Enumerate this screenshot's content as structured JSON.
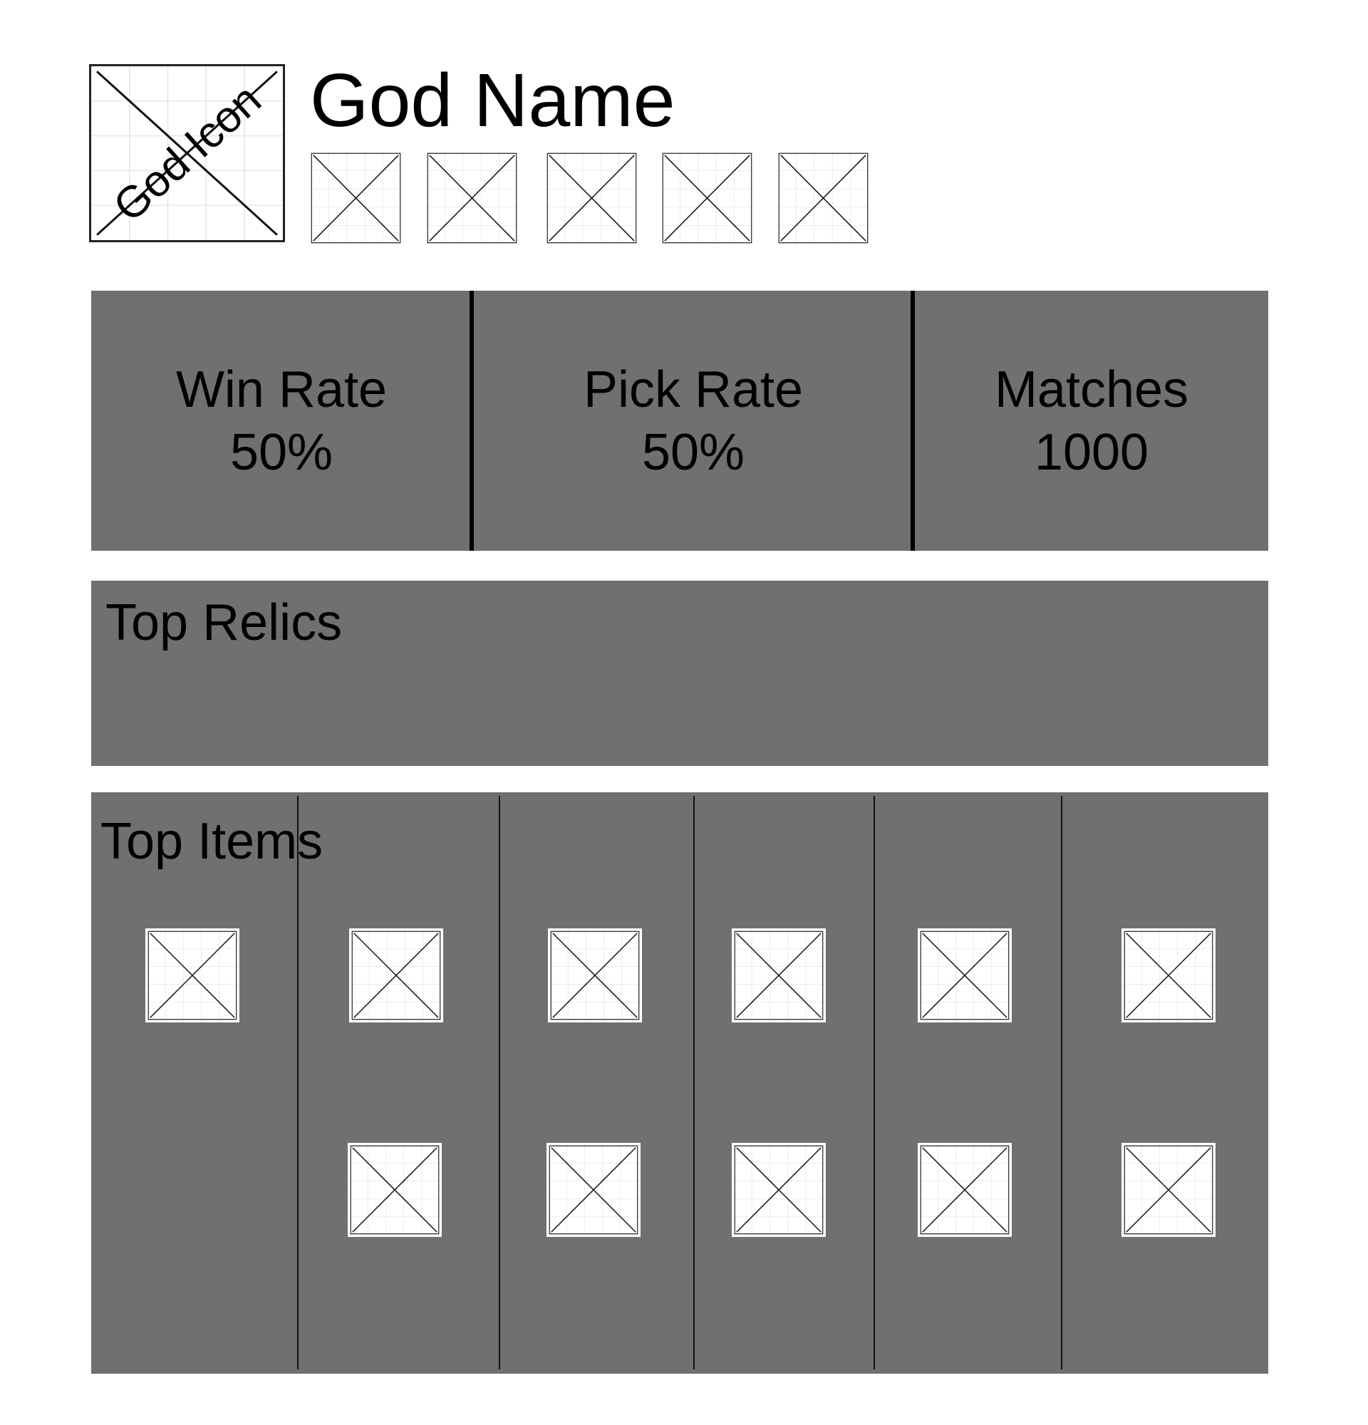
{
  "header": {
    "god_icon_label": "God Icon",
    "god_name": "God Name"
  },
  "stats": [
    {
      "label": "Win Rate",
      "value": "50%"
    },
    {
      "label": "Pick Rate",
      "value": "50%"
    },
    {
      "label": "Matches",
      "value": "1000"
    }
  ],
  "relics": {
    "title": "Top Relics"
  },
  "items": {
    "title": "Top Items"
  },
  "colors": {
    "panel": "#707070"
  }
}
